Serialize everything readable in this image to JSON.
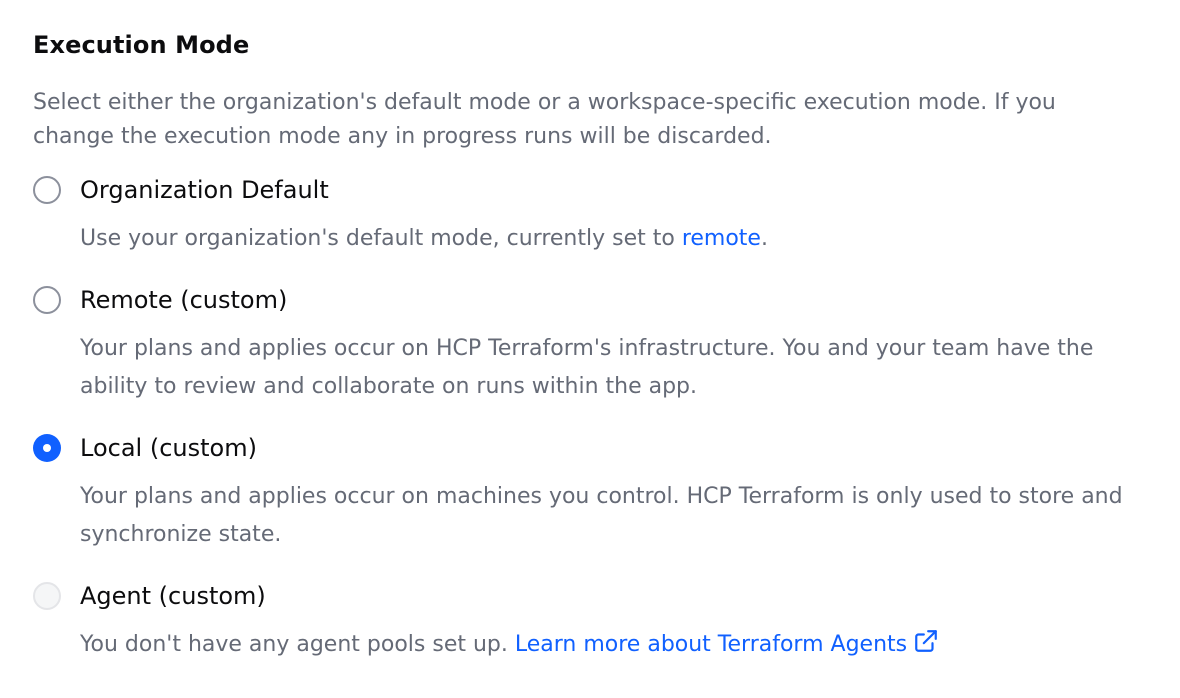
{
  "section": {
    "title": "Execution Mode",
    "description": "Select either the organization's default mode or a workspace-specific execution mode. If you change the execution mode any in progress runs will be discarded."
  },
  "options": [
    {
      "label": "Organization Default",
      "help_prefix": "Use your organization's default mode, currently set to ",
      "help_link": "remote",
      "help_suffix": ".",
      "checked": false,
      "disabled": false
    },
    {
      "label": "Remote (custom)",
      "help": "Your plans and applies occur on HCP Terraform's infrastructure. You and your team have the ability to review and collaborate on runs within the app.",
      "checked": false,
      "disabled": false
    },
    {
      "label": "Local (custom)",
      "help": "Your plans and applies occur on machines you control. HCP Terraform is only used to store and synchronize state.",
      "checked": true,
      "disabled": false
    },
    {
      "label": "Agent (custom)",
      "help_prefix": "You don't have any agent pools set up. ",
      "help_link": "Learn more about Terraform Agents",
      "help_link_icon": "external-link-icon",
      "checked": false,
      "disabled": true
    }
  ],
  "colors": {
    "accent": "#1060ff",
    "text_primary": "#0c0c0e",
    "text_secondary": "#656a76",
    "radio_border": "#8c909c",
    "radio_disabled_border": "#e4e5e8"
  }
}
